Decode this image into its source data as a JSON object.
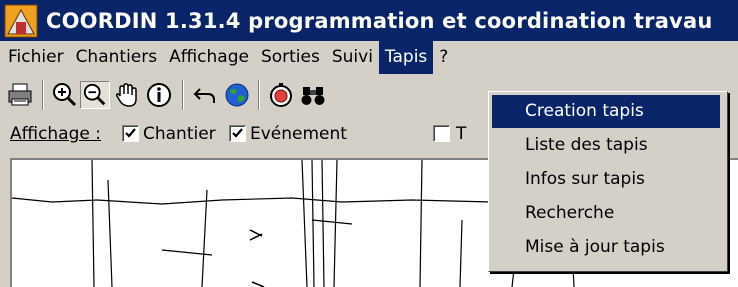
{
  "window": {
    "title": "COORDIN 1.31.4 programmation et coordination travau"
  },
  "menubar": {
    "items": [
      {
        "label": "Fichier"
      },
      {
        "label": "Chantiers"
      },
      {
        "label": "Affichage"
      },
      {
        "label": "Sorties"
      },
      {
        "label": "Suivi"
      },
      {
        "label": "Tapis"
      },
      {
        "label": "?"
      }
    ],
    "active": "Tapis"
  },
  "toolbar": {
    "icons": [
      "printer-icon",
      "zoom-in-icon",
      "zoom-out-icon",
      "pan-hand-icon",
      "info-icon",
      "undo-icon",
      "globe-icon",
      "compass-icon",
      "binoculars-icon"
    ],
    "pressed": "zoom-out-icon"
  },
  "display": {
    "label": "Affichage :",
    "checkboxes": [
      {
        "label": "Chantier",
        "checked": true
      },
      {
        "label": "Evénement",
        "checked": true
      },
      {
        "label": "T",
        "checked": false
      }
    ]
  },
  "tapis_menu": {
    "items": [
      {
        "label": "Creation tapis"
      },
      {
        "label": "Liste des tapis"
      },
      {
        "label": "Infos sur tapis"
      },
      {
        "label": "Recherche"
      },
      {
        "label": "Mise à jour tapis"
      }
    ],
    "selected": "Creation tapis"
  },
  "colors": {
    "titlebar": "#0a246a",
    "chrome": "#d4d0c8",
    "highlight": "#0a246a"
  }
}
